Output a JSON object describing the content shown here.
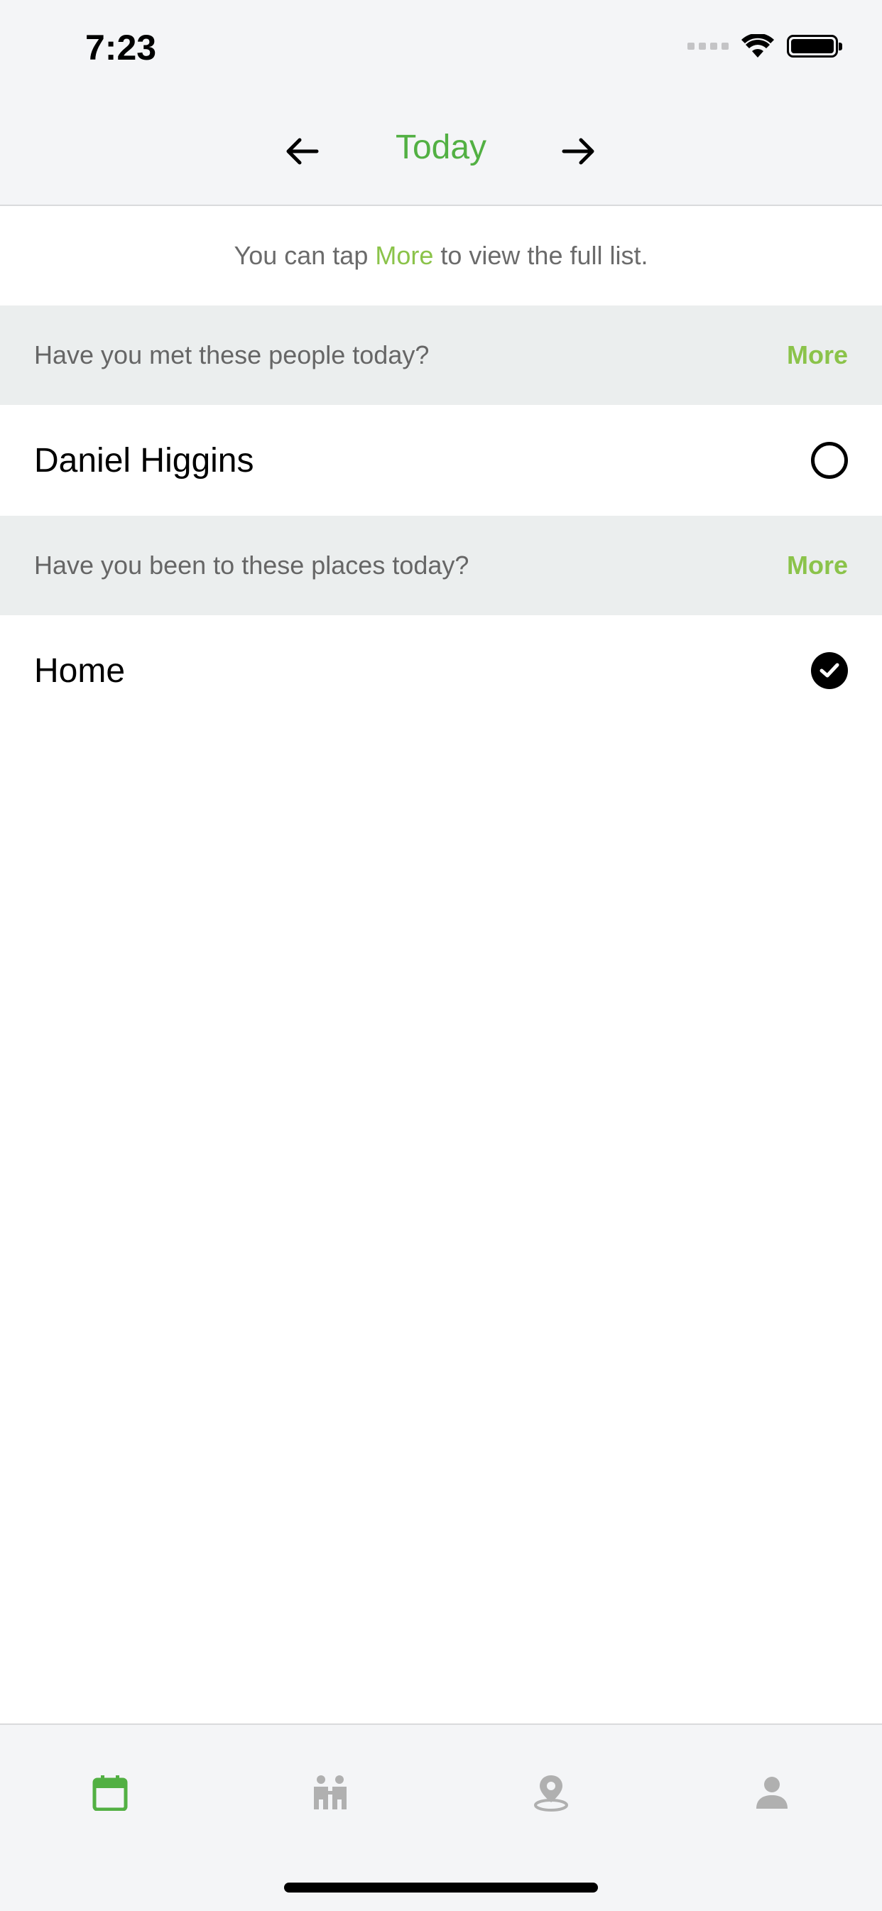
{
  "status_bar": {
    "time": "7:23"
  },
  "header": {
    "title": "Today",
    "prev_icon": "arrow-left-icon",
    "next_icon": "arrow-right-icon"
  },
  "hint": {
    "prefix": "You can tap",
    "accent": "More",
    "suffix": "to view the full list."
  },
  "sections": [
    {
      "title": "Have you met these people today?",
      "more_label": "More",
      "items": [
        {
          "label": "Daniel Higgins",
          "checked": false
        }
      ]
    },
    {
      "title": "Have you been to these places today?",
      "more_label": "More",
      "items": [
        {
          "label": "Home",
          "checked": true
        }
      ]
    }
  ],
  "tabbar": {
    "tabs": [
      {
        "icon": "calendar-icon",
        "active": true
      },
      {
        "icon": "people-icon",
        "active": false
      },
      {
        "icon": "location-pin-icon",
        "active": false
      },
      {
        "icon": "profile-icon",
        "active": false
      }
    ]
  },
  "colors": {
    "accent_green": "#52b043",
    "more_green": "#8bc34a",
    "inactive_icon": "#b0b0b0"
  }
}
